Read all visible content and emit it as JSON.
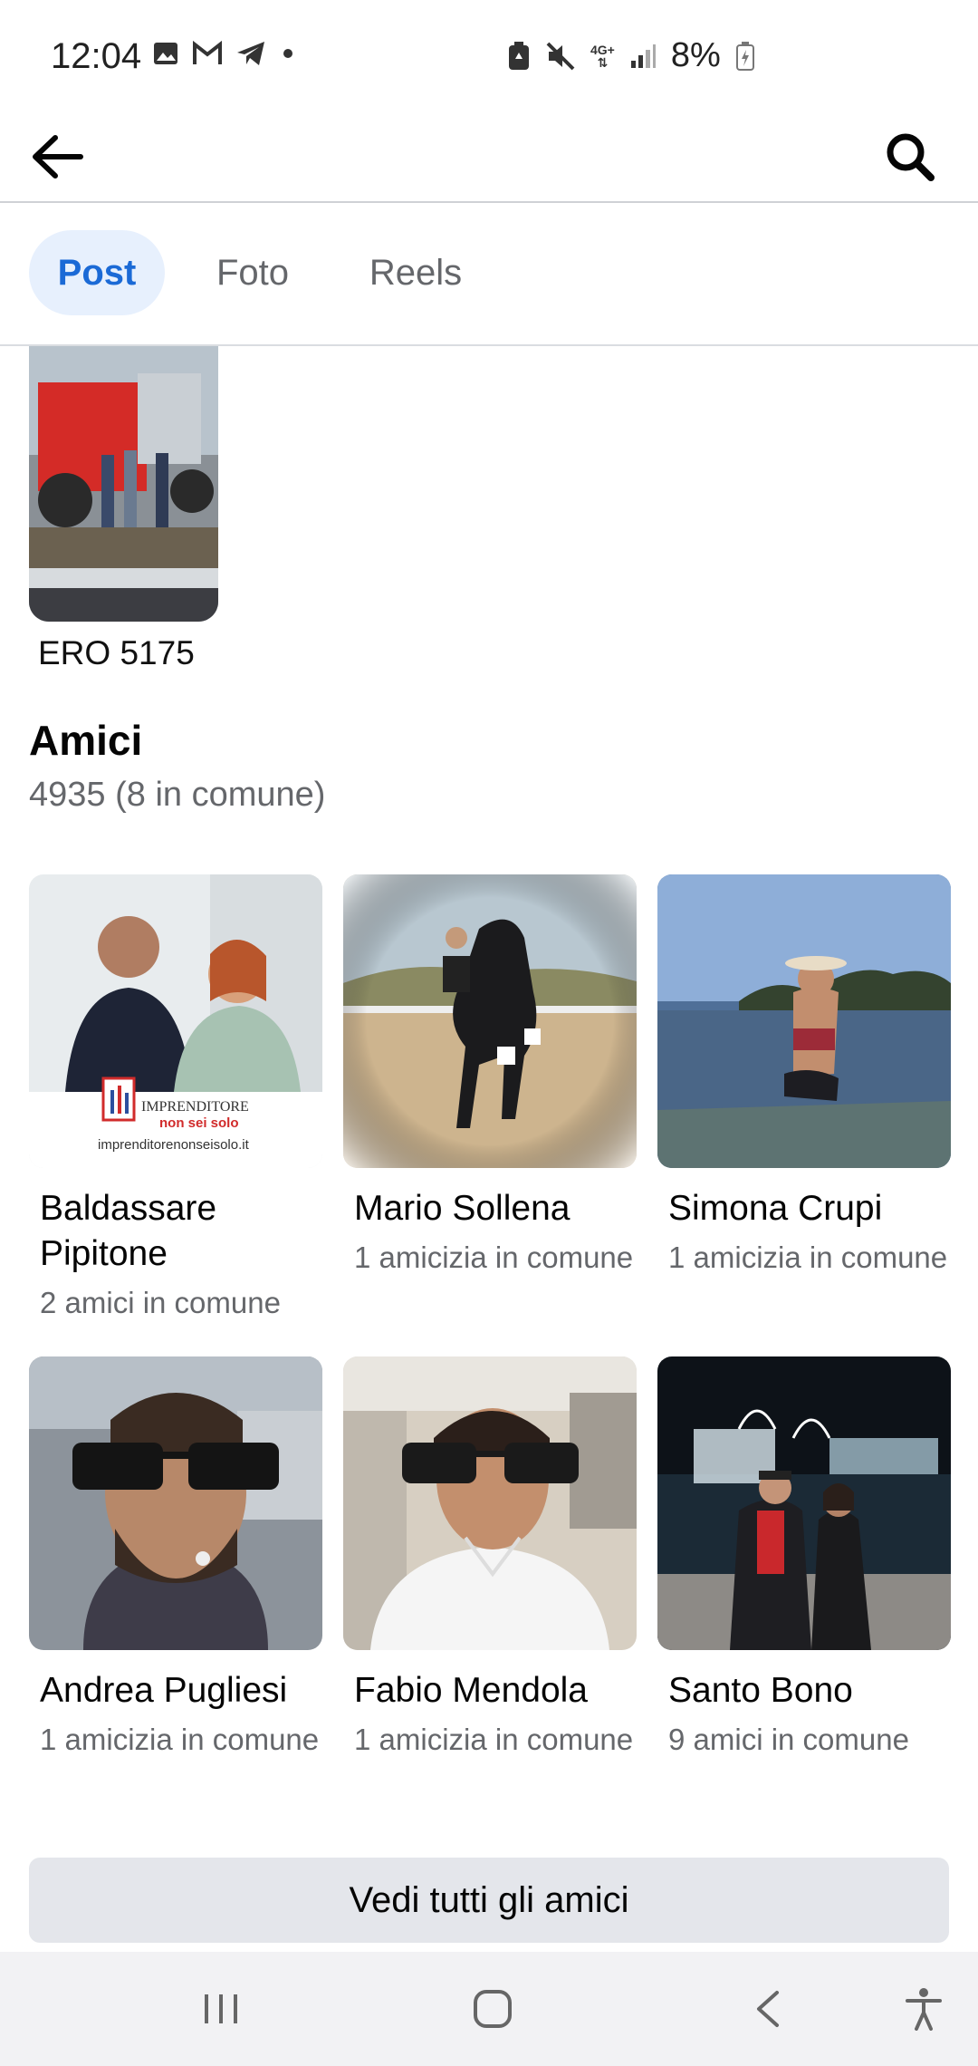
{
  "status_bar": {
    "time": "12:04",
    "network": "4G+",
    "battery": "8%",
    "icons": [
      "image-icon",
      "gmail-icon",
      "telegram-icon",
      "dot-icon",
      "battery-saver-icon",
      "mute-icon",
      "signal-icon",
      "battery-icon"
    ]
  },
  "header": {
    "back_icon": "arrow-left-icon",
    "search_icon": "search-icon"
  },
  "tabs": [
    {
      "label": "Post",
      "active": true
    },
    {
      "label": "Foto",
      "active": false
    },
    {
      "label": "Reels",
      "active": false
    }
  ],
  "post": {
    "caption": "ERO 5175"
  },
  "friends": {
    "title": "Amici",
    "subtitle": "4935 (8 in comune)",
    "items": [
      {
        "name": "Baldassare Pipitone",
        "mutual": "2 amici in comune",
        "photo_text": [
          "IMPRENDITORE",
          "non sei solo",
          "imprenditorenonseisolo.it"
        ]
      },
      {
        "name": "Mario Sollena",
        "mutual": "1 amicizia in comune"
      },
      {
        "name": "Simona Crupi",
        "mutual": "1 amicizia in comune"
      },
      {
        "name": "Andrea Pugliesi",
        "mutual": "1 amicizia in comune"
      },
      {
        "name": "Fabio Mendola",
        "mutual": "1 amicizia in comune"
      },
      {
        "name": "Santo Bono",
        "mutual": "9 amici in comune"
      }
    ],
    "see_all": "Vedi tutti gli amici"
  },
  "nav_bar": {
    "icons": [
      "recent-apps-icon",
      "home-icon",
      "back-icon",
      "accessibility-icon"
    ]
  },
  "colors": {
    "accent": "#1b6ad6",
    "active_tab_bg": "#e7f0fd",
    "secondary_text": "#65676b",
    "button_bg": "#e4e6eb"
  }
}
